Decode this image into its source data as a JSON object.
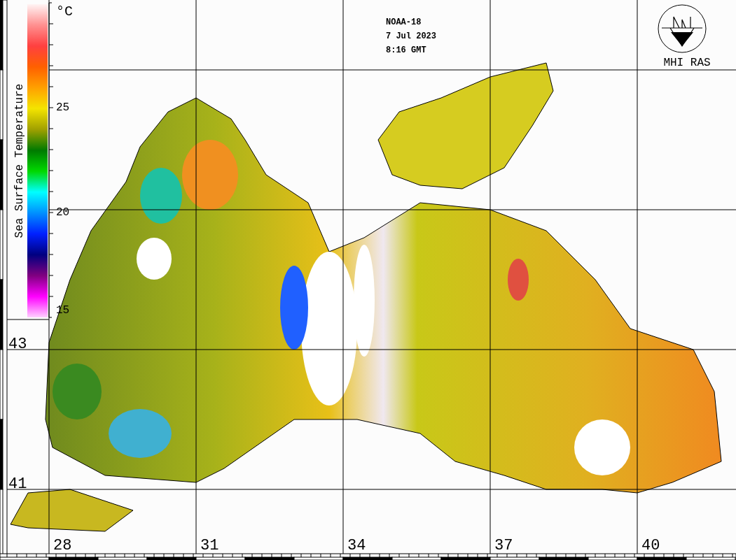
{
  "pass_info": [
    "NOAA-18",
    "7 Jul 2023",
    "8:16 GMT"
  ],
  "logo": {
    "label": "MHI RAS"
  },
  "colorbar": {
    "title": "Sea Surface Temperature",
    "unit": "°C",
    "ticks": [
      "25",
      "20",
      "15"
    ]
  },
  "latitude_labels": [
    "43",
    "41"
  ],
  "longitude_labels": [
    "28",
    "31",
    "34",
    "37",
    "40"
  ]
}
